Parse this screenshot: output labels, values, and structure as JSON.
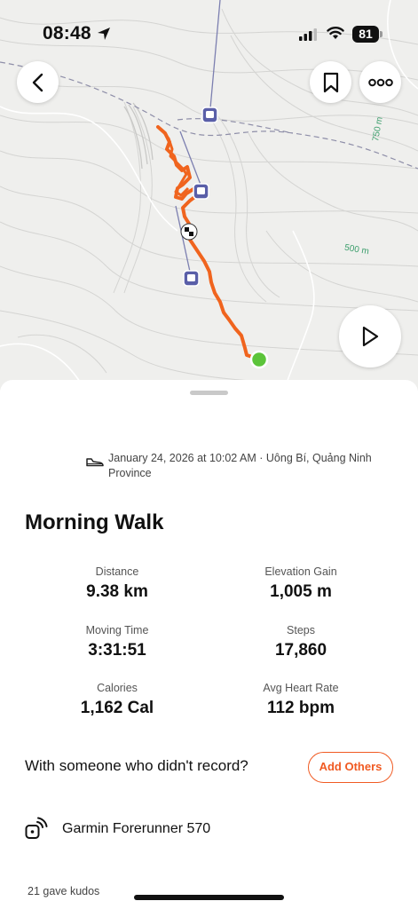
{
  "status_bar": {
    "time": "08:48",
    "battery": "81"
  },
  "map": {
    "contour_labels": [
      "750 m",
      "500 m"
    ],
    "route_color": "#f0641e",
    "end_marker_color": "#5cc43a"
  },
  "activity": {
    "date_location": "January 24, 2026 at 10:02 AM · Uông Bí, Quảng Ninh Province",
    "title": "Morning Walk",
    "stats": [
      {
        "label": "Distance",
        "value": "9.38 km"
      },
      {
        "label": "Elevation Gain",
        "value": "1,005 m"
      },
      {
        "label": "Moving Time",
        "value": "3:31:51"
      },
      {
        "label": "Steps",
        "value": "17,860"
      },
      {
        "label": "Calories",
        "value": "1,162 Cal"
      },
      {
        "label": "Avg Heart Rate",
        "value": "112 bpm"
      }
    ]
  },
  "with_someone": {
    "text": "With someone who didn't record?",
    "button": "Add Others"
  },
  "device": {
    "name": "Garmin Forerunner 570"
  },
  "kudos": "21 gave kudos",
  "colors": {
    "accent": "#f05a22"
  }
}
